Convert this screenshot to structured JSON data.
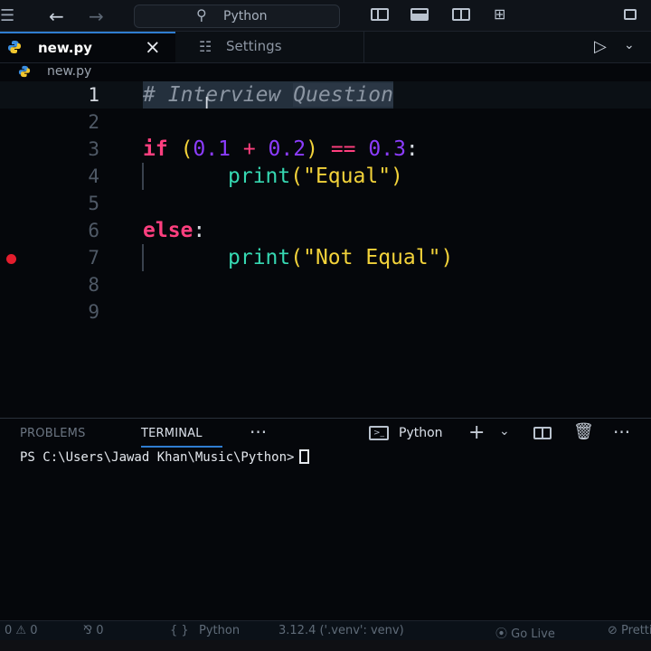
{
  "title_bar": {
    "search_text": "Python",
    "search_icon": "search-icon"
  },
  "tabs": [
    {
      "label": "new.py",
      "active": true,
      "icon": "python-icon",
      "close": "×"
    },
    {
      "label": "Settings",
      "active": false,
      "icon": "settings-icon"
    }
  ],
  "breadcrumb": {
    "file": "new.py"
  },
  "editor": {
    "lines": [
      {
        "number": "1"
      },
      {
        "number": "2"
      },
      {
        "number": "3"
      },
      {
        "number": "4"
      },
      {
        "number": "5"
      },
      {
        "number": "6"
      },
      {
        "number": "7"
      },
      {
        "number": "8"
      },
      {
        "number": "9"
      }
    ],
    "line1": {
      "hash": "#",
      "word1": "Interview",
      "word2": "Question"
    },
    "line3": {
      "kw": "if",
      "open": "(",
      "a": "0.1",
      "plus": "+",
      "b": "0.2",
      "close": ")",
      "eq": "==",
      "c": "0.3",
      "colon": ":"
    },
    "line4": {
      "fn": "print",
      "open": "(",
      "str": "\"Equal\"",
      "close": ")"
    },
    "line6": {
      "kw": "else",
      "colon": ":"
    },
    "line7": {
      "fn": "print",
      "open": "(",
      "str": "\"Not Equal\"",
      "close": ")"
    },
    "breakpoint_line": "7"
  },
  "panel": {
    "tabs": [
      "PROBLEMS",
      "TERMINAL"
    ],
    "active_tab": "TERMINAL",
    "more": "···",
    "terminal_name": "Python",
    "add": "+",
    "prompt": "PS C:\\Users\\Jawad Khan\\Music\\Python>"
  },
  "status_bar": {
    "errors": "0 ⚠ 0",
    "ports": "⅋ 0",
    "braces": "{ }",
    "language": "Python",
    "interpreter": "3.12.4 ('.venv': venv)",
    "go_live": "⦿ Go Live",
    "prettier": "⊘ Prettier"
  },
  "colors": {
    "accent": "#2f7dd1",
    "keyword": "#ff3f7f",
    "number": "#8c3cff",
    "string": "#f2d23a",
    "function": "#36d8b2",
    "breakpoint": "#e41d2d"
  }
}
